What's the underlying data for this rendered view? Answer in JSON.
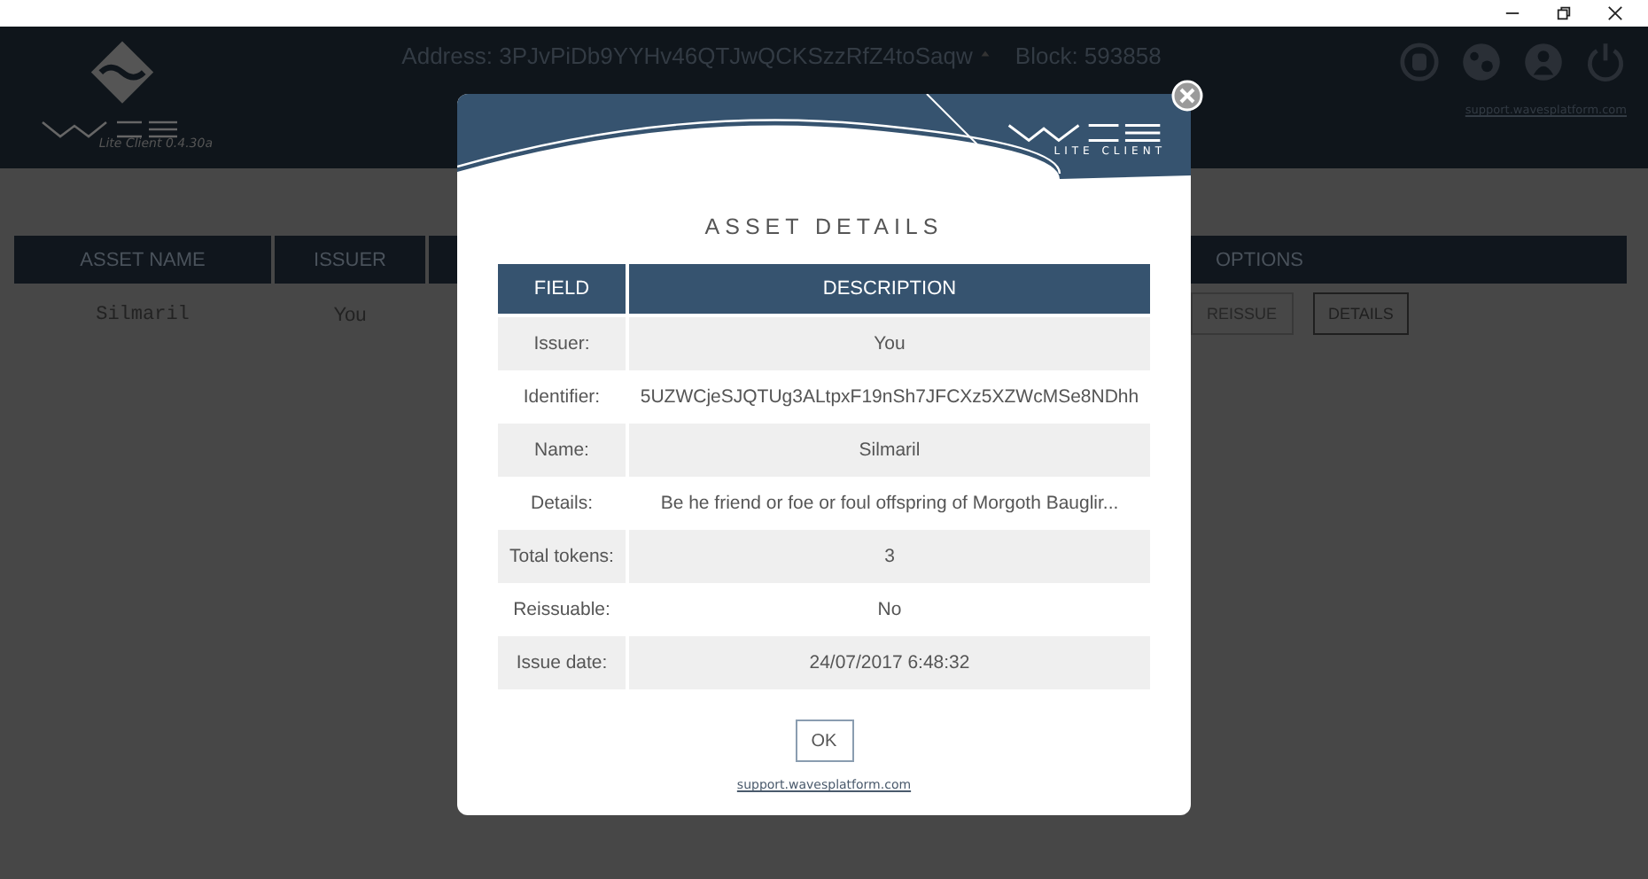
{
  "header": {
    "version": "Lite Client 0.4.30a",
    "address": "Address: 3PJvPiDb9YYHv46QTJwQCKSzzRfZ4toSaqw",
    "block": "Block: 593858",
    "support_link": "support.wavesplatform.com"
  },
  "assets_table": {
    "columns": [
      "ASSET NAME",
      "ISSUER",
      "OPTIONS"
    ],
    "rows": [
      {
        "asset_name": "Silmaril",
        "issuer": "You",
        "actions": [
          {
            "label": "REISSUE",
            "disabled": true
          },
          {
            "label": "DETAILS",
            "disabled": false
          }
        ]
      }
    ]
  },
  "modal": {
    "brand": "LITE CLIENT",
    "title": "ASSET DETAILS",
    "columns": [
      "FIELD",
      "DESCRIPTION"
    ],
    "rows": [
      {
        "field": "Issuer:",
        "description": "You"
      },
      {
        "field": "Identifier:",
        "description": "5UZWCjeSJQTUg3ALtpxF19nSh7JFCXz5XZWcMSe8NDhh"
      },
      {
        "field": "Name:",
        "description": "Silmaril"
      },
      {
        "field": "Details:",
        "description": "Be he friend or foe or foul offspring of Morgoth Bauglir..."
      },
      {
        "field": "Total tokens:",
        "description": "3"
      },
      {
        "field": "Reissuable:",
        "description": "No"
      },
      {
        "field": "Issue date:",
        "description": "24/07/2017 6:48:32"
      }
    ],
    "ok": "OK",
    "link": "support.wavesplatform.com"
  }
}
